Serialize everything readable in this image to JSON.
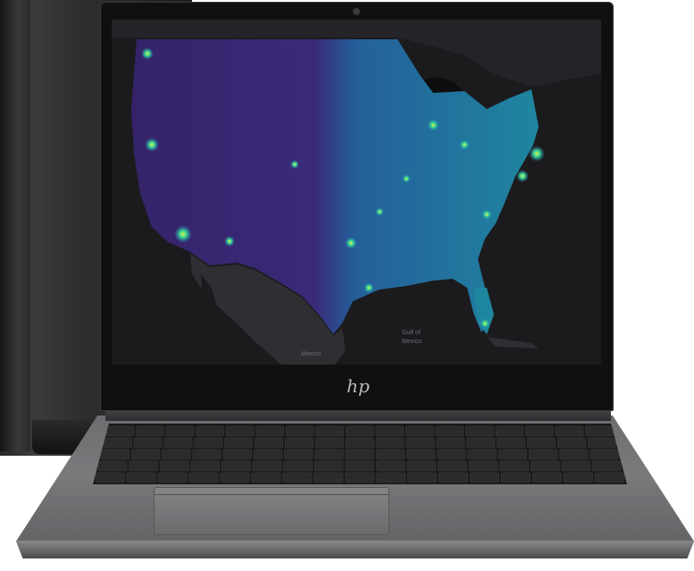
{
  "map": {
    "labels": {
      "gulf_line1": "Gulf of",
      "gulf_line2": "Mexico",
      "mexico": "Mexico"
    }
  },
  "brand": {
    "logo_text": "hp"
  },
  "colors": {
    "density_low": "#3b1f6e",
    "density_mid": "#2a7fa8",
    "density_high": "#33d39b",
    "density_peak": "#d6f24a",
    "map_background": "#1b1b1e",
    "chassis": "#6d6d70"
  }
}
